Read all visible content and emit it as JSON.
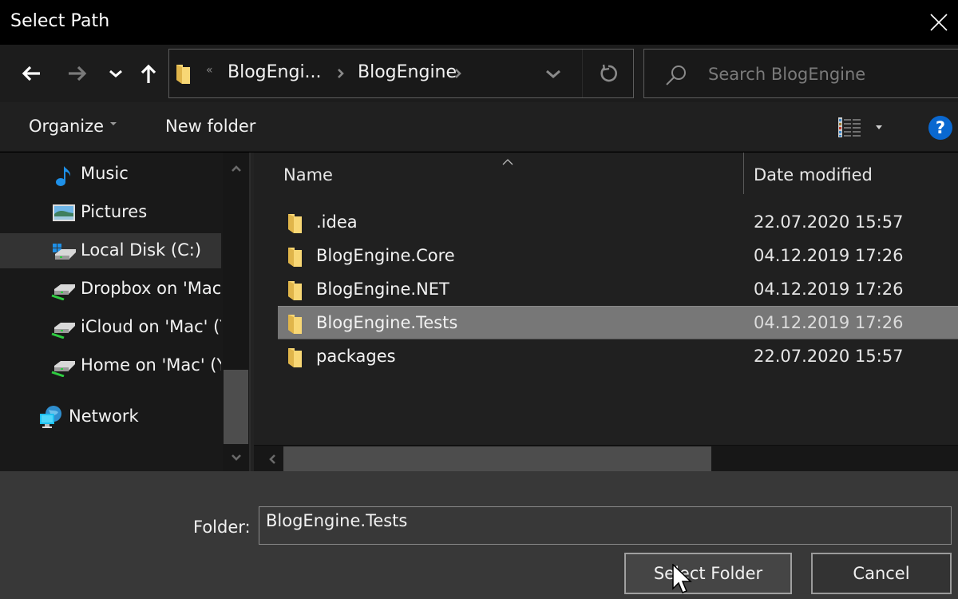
{
  "window": {
    "title": "Select Path",
    "close_icon": "close-icon"
  },
  "navbar": {
    "back_icon": "arrow-left-icon",
    "forward_icon": "arrow-right-icon",
    "recent_icon": "chevron-down-icon",
    "up_icon": "arrow-up-icon",
    "address": {
      "overflow_glyph": "«",
      "breadcrumbs": [
        {
          "label": "BlogEngi..."
        },
        {
          "label": "BlogEngine"
        }
      ],
      "dropdown_icon": "chevron-down-icon",
      "refresh_icon": "refresh-icon"
    },
    "search": {
      "placeholder": "Search BlogEngine",
      "value": ""
    }
  },
  "toolbar": {
    "organize_label": "Organize",
    "new_folder_label": "New folder",
    "view_icon": "details-view-icon",
    "help_label": "?"
  },
  "navpane": {
    "items": [
      {
        "label": "Music",
        "icon": "music-icon",
        "selected": false
      },
      {
        "label": "Pictures",
        "icon": "pictures-icon",
        "selected": false
      },
      {
        "label": "Local Disk (C:)",
        "icon": "local-disk-icon",
        "selected": true
      },
      {
        "label": "Dropbox on 'Mac' (Z:)",
        "icon": "network-drive-icon",
        "selected": false
      },
      {
        "label": "iCloud on 'Mac' (Y:)",
        "icon": "network-drive-icon",
        "selected": false
      },
      {
        "label": "Home on 'Mac' (Y:)",
        "icon": "network-drive-icon",
        "selected": false
      },
      {
        "label": "Network",
        "icon": "network-icon",
        "selected": false
      }
    ]
  },
  "filelist": {
    "columns": [
      {
        "label": "Name",
        "sorted": "ascending"
      },
      {
        "label": "Date modified"
      }
    ],
    "rows": [
      {
        "name": ".idea",
        "date": "22.07.2020 15:57",
        "selected": false
      },
      {
        "name": "BlogEngine.Core",
        "date": "04.12.2019 17:26",
        "selected": false
      },
      {
        "name": "BlogEngine.NET",
        "date": "04.12.2019 17:26",
        "selected": false
      },
      {
        "name": "BlogEngine.Tests",
        "date": "04.12.2019 17:26",
        "selected": true
      },
      {
        "name": "packages",
        "date": "22.07.2020 15:57",
        "selected": false
      }
    ]
  },
  "footer": {
    "folder_label": "Folder:",
    "folder_value": "BlogEngine.Tests",
    "select_button": "Select Folder",
    "cancel_button": "Cancel"
  },
  "colors": {
    "title_bg": "#000000",
    "nav_bg": "#1c1c1c",
    "list_bg": "#202020",
    "selection_bg": "#777777",
    "footer_bg": "#383838",
    "help_accent": "#0a68d0",
    "folder_yellow": "#f8d775"
  }
}
